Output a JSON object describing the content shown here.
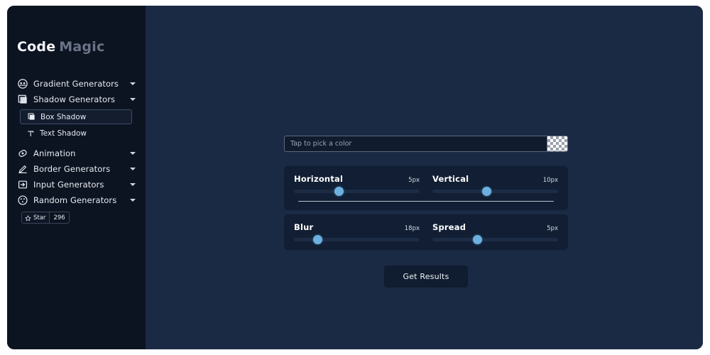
{
  "app": {
    "logo_primary": "Code",
    "logo_secondary": "Magic"
  },
  "colors": {
    "page_border": "#ffffff",
    "sidebar_bg": "#0d1421",
    "main_bg": "#1b2a44",
    "card_bg": "#111e33",
    "accent": "#6cb0e0",
    "text": "#e6ebf3",
    "muted": "#6a7487",
    "divider": "#b9c2cf"
  },
  "sidebar": {
    "items": [
      {
        "label": "Gradient Generators",
        "icon": "gradient-circle-icon",
        "caret": "chevron-down-icon"
      },
      {
        "label": "Shadow Generators",
        "icon": "square-shadow-icon",
        "caret": "chevron-down-icon"
      },
      {
        "label": "Animation",
        "icon": "animation-icon",
        "caret": "chevron-down-icon"
      },
      {
        "label": "Border Generators",
        "icon": "pen-icon",
        "caret": "chevron-down-icon"
      },
      {
        "label": "Input Generators",
        "icon": "input-arrow-icon",
        "caret": "chevron-down-icon"
      },
      {
        "label": "Random Generators",
        "icon": "dice-icon",
        "caret": "chevron-down-icon"
      }
    ],
    "submenu": [
      {
        "label": "Box Shadow",
        "icon": "box-shadow-icon",
        "active": true
      },
      {
        "label": "Text Shadow",
        "icon": "text-shadow-icon",
        "active": false
      }
    ],
    "star_button": {
      "label": "Star",
      "count": "296",
      "icon": "star-icon"
    }
  },
  "main": {
    "color_picker": {
      "placeholder": "Tap to pick a color",
      "value": "",
      "swatch": "transparent-checkerboard"
    },
    "sliders": [
      {
        "name": "Horizontal",
        "value": "5px",
        "percent": 36
      },
      {
        "name": "Vertical",
        "value": "10px",
        "percent": 43
      },
      {
        "name": "Blur",
        "value": "18px",
        "percent": 19
      },
      {
        "name": "Spread",
        "value": "5px",
        "percent": 36
      }
    ],
    "results_button": "Get Results"
  }
}
